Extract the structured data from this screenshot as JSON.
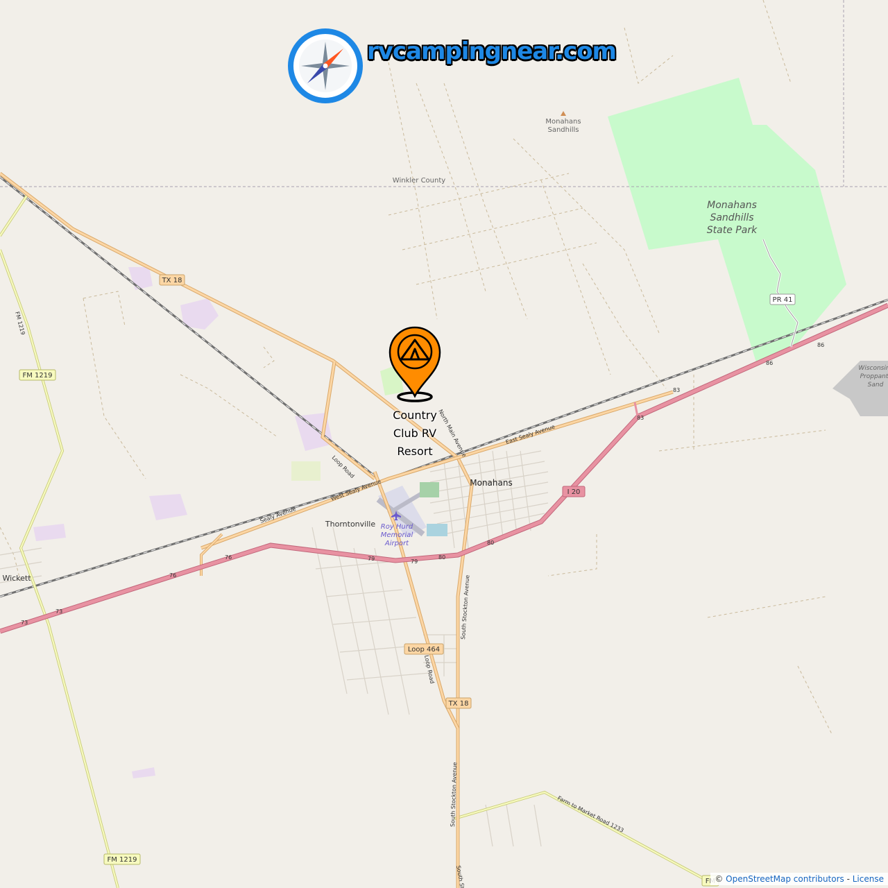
{
  "brand": {
    "name": "rvcampingnear.com",
    "icon": "compass-icon",
    "color": "#1e88e5"
  },
  "marker": {
    "label_lines": [
      "Country",
      "Club RV",
      "Resort"
    ],
    "icon": "tent-pin-icon",
    "color": "#ff8c00"
  },
  "places": {
    "monahans": "Monahans",
    "thorntonville": "Thorntonville",
    "wickett": "Wickett",
    "winkler_county": "Winkler County",
    "sandhills_line1": "Monahans",
    "sandhills_line2": "Sandhills",
    "park_line1": "Monahans",
    "park_line2": "Sandhills",
    "park_line3": "State Park",
    "airport_line1": "Roy Hurd",
    "airport_line2": "Memorial",
    "airport_line3": "Airport",
    "wisconsin_line1": "Wisconsin",
    "wisconsin_line2": "Proppant",
    "wisconsin_line3": "Sand"
  },
  "shields": {
    "tx18_north": "TX 18",
    "tx18_south": "TX 18",
    "fm1219_north": "FM 1219",
    "fm1219_south": "FM 1219",
    "pr41": "PR 41",
    "i20": "I 20",
    "loop464": "Loop 464",
    "fm_bottom": "FM"
  },
  "road_labels": {
    "loop_road": "Loop Road",
    "loop_road_south": "Loop Road",
    "west_sealy": "West Sealy Avenue",
    "sealy": "Sealy Avenue",
    "east_sealy": "East Sealy Avenue",
    "main_avenue": "North Main Avenue",
    "south_stockton": "South Stockton Avenue",
    "south_stockton_lower": "South Stockton Avenue",
    "south_st": "South St",
    "farm_to_market": "Farm to Market Road 1233",
    "fm1219_side": "FM 1219",
    "exit_73a": "73",
    "exit_73b": "73",
    "exit_76a": "76",
    "exit_76b": "76",
    "exit_79a": "79",
    "exit_79b": "79",
    "exit_80a": "80",
    "exit_80b": "80",
    "exit_83a": "83",
    "exit_83b": "83",
    "exit_86a": "86",
    "exit_86b": "86"
  },
  "colors": {
    "land": "#f2efe9",
    "park": "#c8facc",
    "motorway": "#e892a2",
    "primary": "#fcd6a4",
    "secondary": "#f7fabf",
    "railway": "#707070"
  },
  "attribution": {
    "prefix": "© ",
    "link": "OpenStreetMap contributors",
    "separator": " - ",
    "license": "License"
  }
}
